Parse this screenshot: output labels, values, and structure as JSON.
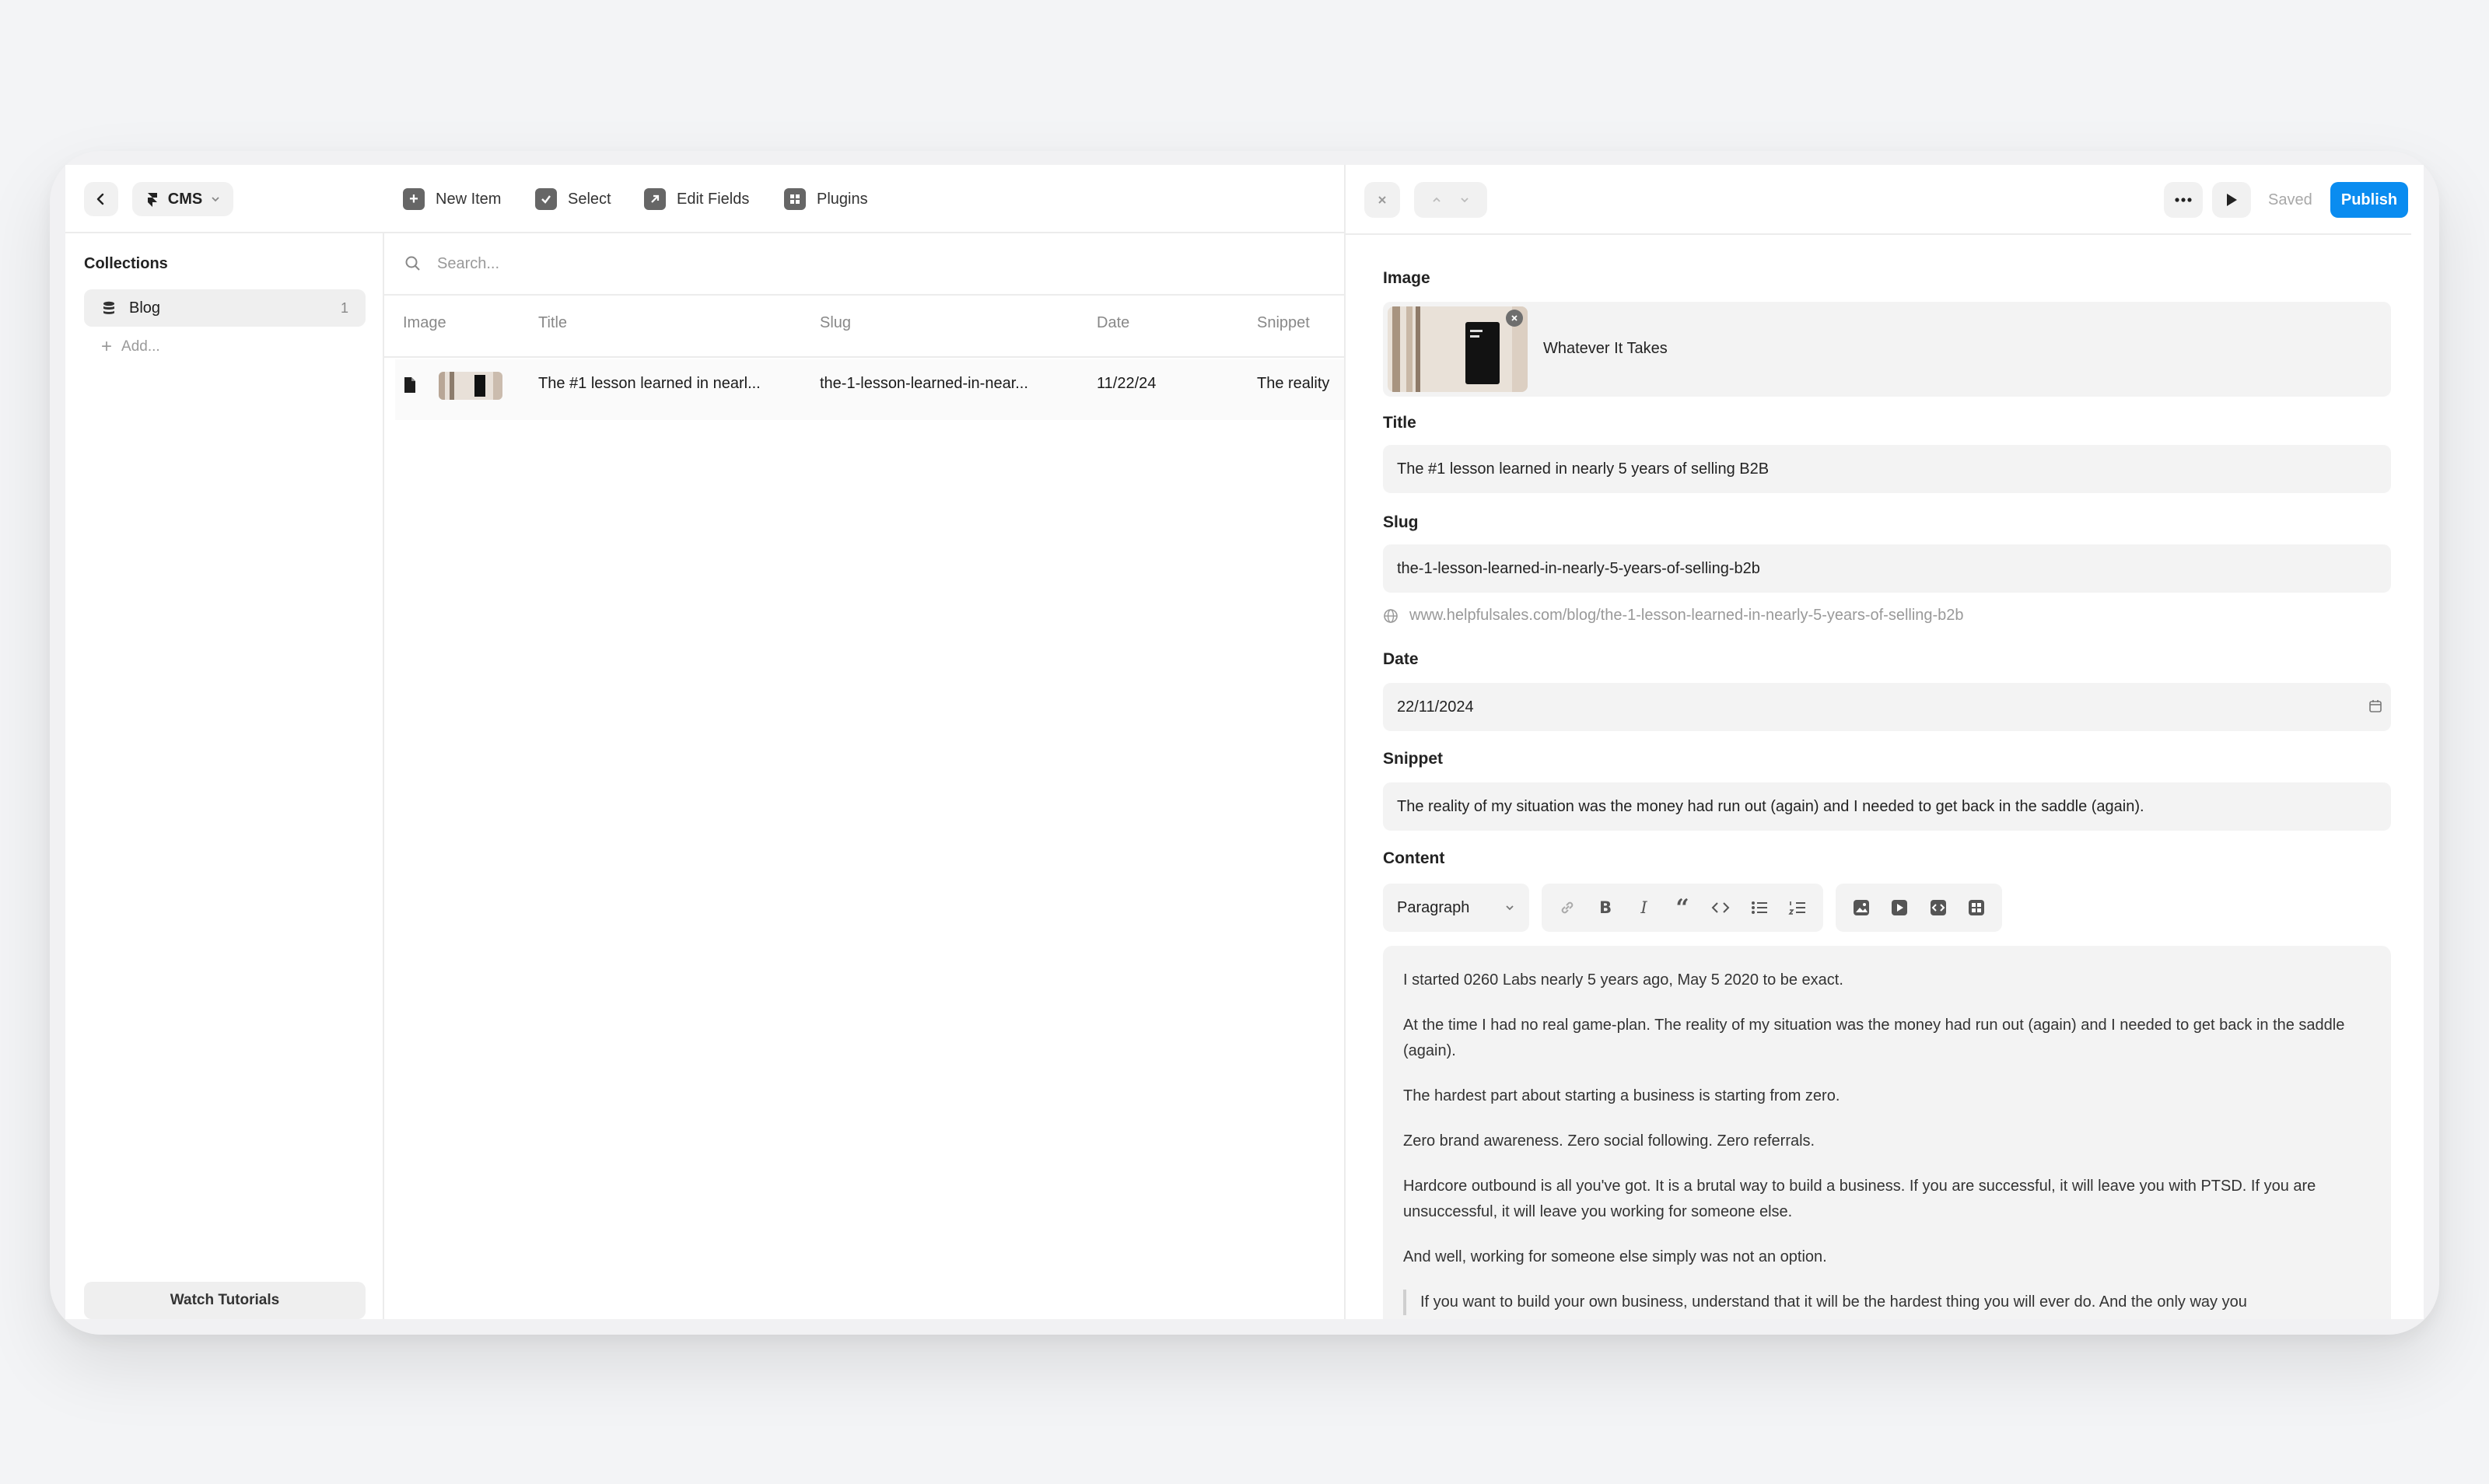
{
  "header": {
    "app_label": "CMS",
    "toolbar": {
      "new_item": "New Item",
      "select": "Select",
      "edit_fields": "Edit Fields",
      "plugins": "Plugins"
    }
  },
  "sidebar": {
    "collections_title": "Collections",
    "items": [
      {
        "label": "Blog",
        "count": "1"
      }
    ],
    "add_label": "Add...",
    "watch_tutorials": "Watch Tutorials"
  },
  "list": {
    "search_placeholder": "Search...",
    "columns": [
      "Image",
      "Title",
      "Slug",
      "Date",
      "Snippet"
    ],
    "rows": [
      {
        "title": "The #1 lesson learned in nearl...",
        "slug": "the-1-lesson-learned-in-near...",
        "date": "11/22/24",
        "snippet": "The reality"
      }
    ]
  },
  "editor": {
    "saved_label": "Saved",
    "publish_label": "Publish",
    "image_label": "Image",
    "image_caption": "Whatever It Takes",
    "title_label": "Title",
    "title_value": "The #1 lesson learned in nearly 5 years of selling B2B",
    "slug_label": "Slug",
    "slug_value": "the-1-lesson-learned-in-nearly-5-years-of-selling-b2b",
    "url_preview": "www.helpfulsales.com/blog/the-1-lesson-learned-in-nearly-5-years-of-selling-b2b",
    "date_label": "Date",
    "date_value": "22/11/2024",
    "snippet_label": "Snippet",
    "snippet_value": "The reality of my situation was the money had run out (again) and I needed to get back in the saddle (again).",
    "content_label": "Content",
    "format_select": "Paragraph",
    "content": {
      "p1": "I started 0260 Labs nearly 5 years ago, May 5 2020 to be exact.",
      "p2": "At the time I had no real game-plan. The reality of my situation was the money had run out (again) and I needed to get back in the saddle (again).",
      "p3": "The hardest part about starting a business is starting from zero.",
      "p4": "Zero brand awareness. Zero social following. Zero referrals.",
      "p5": "Hardcore outbound is all you've got. It is a brutal way to build a business. If you are successful, it will leave you with PTSD. If you are unsuccessful, it will leave you working for someone else.",
      "p6": "And well, working for someone else simply was not an option.",
      "quote": "If you want to build your own business, understand that it will be the hardest thing you will ever do. And the only way you"
    }
  },
  "colors": {
    "accent": "#0a8cf0",
    "background": "#f3f4f6"
  }
}
